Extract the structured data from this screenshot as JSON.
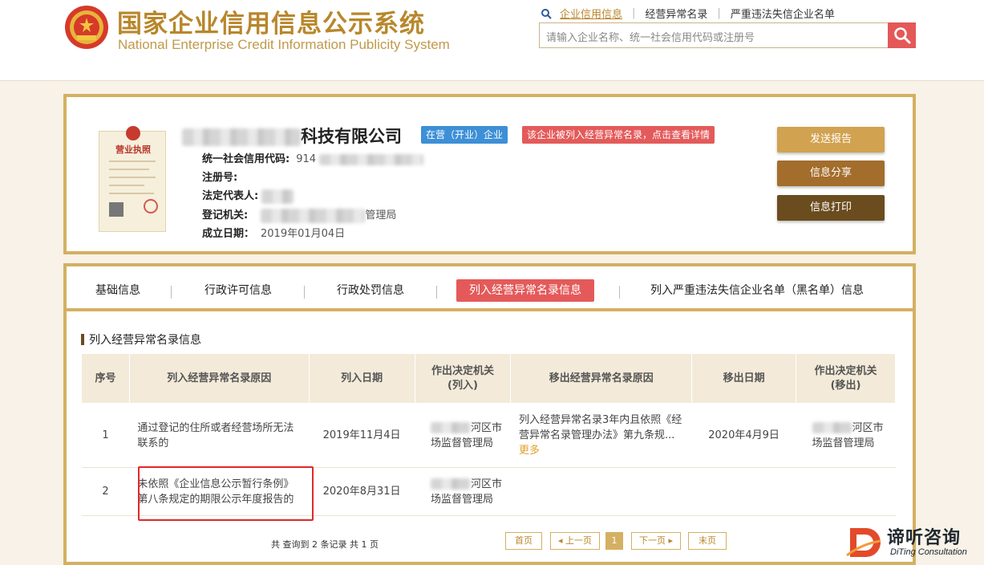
{
  "header": {
    "logo_cn": "国家企业信用信息公示系统",
    "logo_en": "National Enterprise Credit Information Publicity System",
    "links": [
      "企业信用信息",
      "经营异常名录",
      "严重违法失信企业名单"
    ],
    "search_placeholder": "请输入企业名称、统一社会信用代码或注册号",
    "accent_color": "#b8872c",
    "search_button_color": "#e45858"
  },
  "company": {
    "name_suffix": "科技有限公司",
    "status_badge": "在营（开业）企业",
    "alert_badge": "该企业被列入经营异常名录，点击查看详情",
    "credit_code_label": "统一社会信用代码:",
    "credit_code_value": "914",
    "reg_no_label": "注册号:",
    "legal_rep_label": "法定代表人:",
    "authority_label": "登记机关:",
    "authority_value_suffix": "管理局",
    "est_date_label": "成立日期：",
    "est_date_value": "2019年01月04日",
    "license_title": "营业执照"
  },
  "actions": {
    "send_report": "发送报告",
    "share": "信息分享",
    "print": "信息打印"
  },
  "tabs": [
    "基础信息",
    "行政许可信息",
    "行政处罚信息",
    "列入经营异常名录信息",
    "列入严重违法失信企业名单（黑名单）信息"
  ],
  "active_tab_index": 3,
  "section_title": "列入经营异常名录信息",
  "table": {
    "headers": [
      "序号",
      "列入经营异常名录原因",
      "列入日期",
      "作出决定机关(列入)",
      "移出经营异常名录原因",
      "移出日期",
      "作出决定机关(移出)"
    ],
    "rows": [
      {
        "no": "1",
        "reason": "通过登记的住所或者经营场所无法联系的",
        "date": "2019年11月4日",
        "authority": "河区市场监督管理局",
        "remove_reason": "列入经营异常名录3年内且依照《经营异常名录管理办法》第九条规...",
        "more": "更多",
        "remove_date": "2020年4月9日",
        "remove_authority": "河区市场监督管理局"
      },
      {
        "no": "2",
        "reason": "未依照《企业信息公示暂行条例》第八条规定的期限公示年度报告的",
        "date": "2020年8月31日",
        "authority": "河区市场监督管理局",
        "remove_reason": "",
        "more": "",
        "remove_date": "",
        "remove_authority": ""
      }
    ]
  },
  "pager": {
    "summary": "共 查询到 2 条记录 共 1 页",
    "first": "首页",
    "prev": "上一页",
    "current": "1",
    "next": "下一页",
    "last": "末页"
  },
  "watermark": {
    "cn": "谛听咨询",
    "en": "DiTing Consultation"
  }
}
